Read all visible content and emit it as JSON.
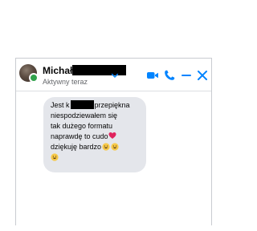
{
  "contact": {
    "name": "Michał",
    "status": "Aktywny teraz",
    "online": true
  },
  "header": {
    "icons": [
      "chevron-down-icon",
      "video-call-icon",
      "phone-icon",
      "minimize-icon",
      "close-icon"
    ]
  },
  "message": {
    "line1_before": "Jest k",
    "line1_after": "przepiękna",
    "line2": "niespodziewałem się",
    "line3": "tak dużego formatu",
    "line4": "naprawdę to cudo",
    "line5": "dziękuję bardzo",
    "emojis": [
      "heart-emoji",
      "grinning-emoji",
      "grinning-emoji",
      "grinning-emoji"
    ]
  },
  "colors": {
    "accent": "#0084ff",
    "bubble": "#e4e6eb",
    "online": "#31a24c",
    "heart": "#e0245e",
    "emoji": "#f7c948"
  }
}
